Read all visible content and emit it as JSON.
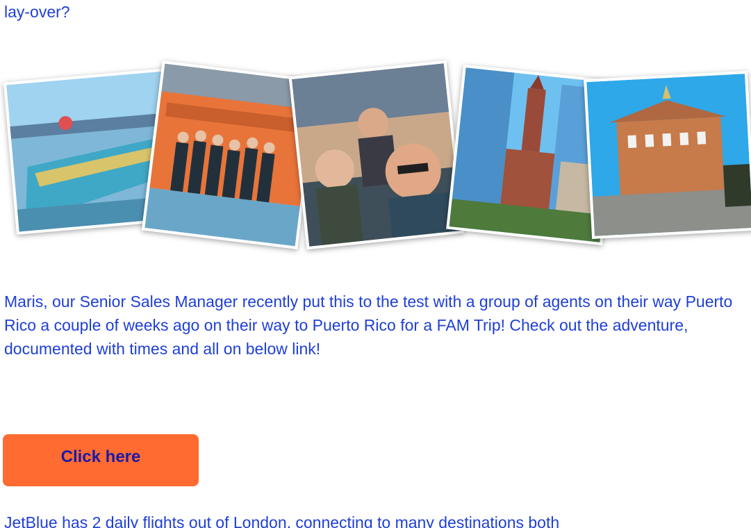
{
  "content": {
    "top_text": "lay-over?",
    "paragraph": "Maris, our Senior Sales Manager recently put this to the test with a group of agents on their way Puerto Rico a couple of weeks ago on their way to Puerto Rico for a FAM Trip! Check out the adventure, documented with times and all on below link!",
    "button_label": "Click here",
    "bottom_text": "JetBlue has 2 daily flights out of London, connecting to many destinations both"
  },
  "colors": {
    "text": "#1f3fd6",
    "button_bg": "#ff6b30",
    "button_text": "#1a1aa8"
  },
  "collage": {
    "photos": [
      {
        "name": "harbor-boat-photo",
        "description_icon": "boat-icon"
      },
      {
        "name": "group-duck-boat-photo",
        "description_icon": "group-icon"
      },
      {
        "name": "selfie-bus-photo",
        "description_icon": "selfie-icon"
      },
      {
        "name": "old-church-skyline-photo",
        "description_icon": "church-icon"
      },
      {
        "name": "faneuil-hall-photo",
        "description_icon": "building-icon"
      }
    ]
  }
}
